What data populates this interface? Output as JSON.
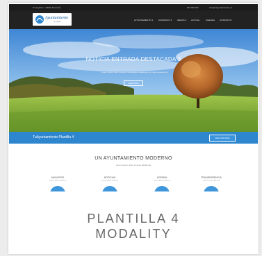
{
  "topbar": {
    "address": "Pl. España 1, 28000 Provincia",
    "phone": "999 999 999",
    "email": "info@miayuntamiento.es"
  },
  "logo": {
    "name": "Ayuntamiento",
    "sub": "municipio"
  },
  "nav": [
    "AYUNTAMIENTO ▾",
    "MUNICIPIO ▾",
    "ÁREAS ▾",
    "ACTUAL",
    "AGENDA",
    "CONTACTO"
  ],
  "hero": {
    "title": "NOTICIA ENTRADA DESTACADA 3",
    "subtitle": "Lorem ipsum dolor sit amet, consectetur adipiscing elit, sed do eiusmod",
    "button": "LEER MÁS"
  },
  "bluebar": {
    "text": "TuAyuntamiento Plantilla 4",
    "button": "VER MÁS INFO"
  },
  "section": {
    "title": "UN AYUNTAMIENTO MODERNO",
    "subtitle": "Lorem ipsum dolor sit amet adipiscing"
  },
  "features": [
    {
      "title": "MUNICIPIO",
      "desc": "Lorem ipsum dolor sit"
    },
    {
      "title": "NOTICIAS",
      "desc": "Lorem ipsum dolor sit"
    },
    {
      "title": "AGENDA",
      "desc": "Lorem ipsum dolor sit"
    },
    {
      "title": "TRANSPARENCIA",
      "desc": "Lorem ipsum dolor sit"
    }
  ],
  "card_title_line1": "PLANTILLA 4",
  "card_title_line2": "MODALITY",
  "colors": {
    "accent": "#2e86cf",
    "dark": "#222222",
    "title": "#666666"
  }
}
